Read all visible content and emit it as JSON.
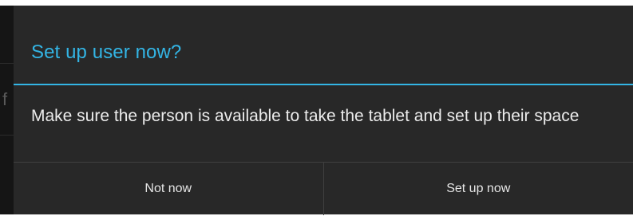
{
  "background": {
    "fragment_text": "f"
  },
  "dialog": {
    "title": "Set up user now?",
    "message": "Make sure the person is available to take the tablet and set up their space",
    "buttons": {
      "negative_label": "Not now",
      "positive_label": "Set up now"
    }
  },
  "colors": {
    "accent": "#33b5e5",
    "dialog_background": "#282828",
    "backdrop": "#151515",
    "text": "#ececec"
  }
}
